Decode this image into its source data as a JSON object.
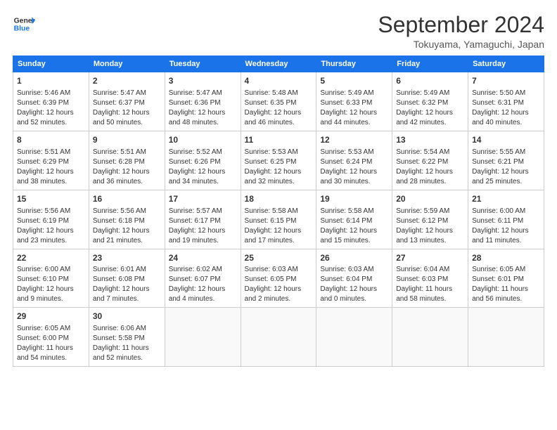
{
  "logo": {
    "line1": "General",
    "line2": "Blue"
  },
  "title": "September 2024",
  "location": "Tokuyama, Yamaguchi, Japan",
  "days_of_week": [
    "Sunday",
    "Monday",
    "Tuesday",
    "Wednesday",
    "Thursday",
    "Friday",
    "Saturday"
  ],
  "weeks": [
    [
      {
        "day": 1,
        "lines": [
          "Sunrise: 5:46 AM",
          "Sunset: 6:39 PM",
          "Daylight: 12 hours",
          "and 52 minutes."
        ]
      },
      {
        "day": 2,
        "lines": [
          "Sunrise: 5:47 AM",
          "Sunset: 6:37 PM",
          "Daylight: 12 hours",
          "and 50 minutes."
        ]
      },
      {
        "day": 3,
        "lines": [
          "Sunrise: 5:47 AM",
          "Sunset: 6:36 PM",
          "Daylight: 12 hours",
          "and 48 minutes."
        ]
      },
      {
        "day": 4,
        "lines": [
          "Sunrise: 5:48 AM",
          "Sunset: 6:35 PM",
          "Daylight: 12 hours",
          "and 46 minutes."
        ]
      },
      {
        "day": 5,
        "lines": [
          "Sunrise: 5:49 AM",
          "Sunset: 6:33 PM",
          "Daylight: 12 hours",
          "and 44 minutes."
        ]
      },
      {
        "day": 6,
        "lines": [
          "Sunrise: 5:49 AM",
          "Sunset: 6:32 PM",
          "Daylight: 12 hours",
          "and 42 minutes."
        ]
      },
      {
        "day": 7,
        "lines": [
          "Sunrise: 5:50 AM",
          "Sunset: 6:31 PM",
          "Daylight: 12 hours",
          "and 40 minutes."
        ]
      }
    ],
    [
      {
        "day": 8,
        "lines": [
          "Sunrise: 5:51 AM",
          "Sunset: 6:29 PM",
          "Daylight: 12 hours",
          "and 38 minutes."
        ]
      },
      {
        "day": 9,
        "lines": [
          "Sunrise: 5:51 AM",
          "Sunset: 6:28 PM",
          "Daylight: 12 hours",
          "and 36 minutes."
        ]
      },
      {
        "day": 10,
        "lines": [
          "Sunrise: 5:52 AM",
          "Sunset: 6:26 PM",
          "Daylight: 12 hours",
          "and 34 minutes."
        ]
      },
      {
        "day": 11,
        "lines": [
          "Sunrise: 5:53 AM",
          "Sunset: 6:25 PM",
          "Daylight: 12 hours",
          "and 32 minutes."
        ]
      },
      {
        "day": 12,
        "lines": [
          "Sunrise: 5:53 AM",
          "Sunset: 6:24 PM",
          "Daylight: 12 hours",
          "and 30 minutes."
        ]
      },
      {
        "day": 13,
        "lines": [
          "Sunrise: 5:54 AM",
          "Sunset: 6:22 PM",
          "Daylight: 12 hours",
          "and 28 minutes."
        ]
      },
      {
        "day": 14,
        "lines": [
          "Sunrise: 5:55 AM",
          "Sunset: 6:21 PM",
          "Daylight: 12 hours",
          "and 25 minutes."
        ]
      }
    ],
    [
      {
        "day": 15,
        "lines": [
          "Sunrise: 5:56 AM",
          "Sunset: 6:19 PM",
          "Daylight: 12 hours",
          "and 23 minutes."
        ]
      },
      {
        "day": 16,
        "lines": [
          "Sunrise: 5:56 AM",
          "Sunset: 6:18 PM",
          "Daylight: 12 hours",
          "and 21 minutes."
        ]
      },
      {
        "day": 17,
        "lines": [
          "Sunrise: 5:57 AM",
          "Sunset: 6:17 PM",
          "Daylight: 12 hours",
          "and 19 minutes."
        ]
      },
      {
        "day": 18,
        "lines": [
          "Sunrise: 5:58 AM",
          "Sunset: 6:15 PM",
          "Daylight: 12 hours",
          "and 17 minutes."
        ]
      },
      {
        "day": 19,
        "lines": [
          "Sunrise: 5:58 AM",
          "Sunset: 6:14 PM",
          "Daylight: 12 hours",
          "and 15 minutes."
        ]
      },
      {
        "day": 20,
        "lines": [
          "Sunrise: 5:59 AM",
          "Sunset: 6:12 PM",
          "Daylight: 12 hours",
          "and 13 minutes."
        ]
      },
      {
        "day": 21,
        "lines": [
          "Sunrise: 6:00 AM",
          "Sunset: 6:11 PM",
          "Daylight: 12 hours",
          "and 11 minutes."
        ]
      }
    ],
    [
      {
        "day": 22,
        "lines": [
          "Sunrise: 6:00 AM",
          "Sunset: 6:10 PM",
          "Daylight: 12 hours",
          "and 9 minutes."
        ]
      },
      {
        "day": 23,
        "lines": [
          "Sunrise: 6:01 AM",
          "Sunset: 6:08 PM",
          "Daylight: 12 hours",
          "and 7 minutes."
        ]
      },
      {
        "day": 24,
        "lines": [
          "Sunrise: 6:02 AM",
          "Sunset: 6:07 PM",
          "Daylight: 12 hours",
          "and 4 minutes."
        ]
      },
      {
        "day": 25,
        "lines": [
          "Sunrise: 6:03 AM",
          "Sunset: 6:05 PM",
          "Daylight: 12 hours",
          "and 2 minutes."
        ]
      },
      {
        "day": 26,
        "lines": [
          "Sunrise: 6:03 AM",
          "Sunset: 6:04 PM",
          "Daylight: 12 hours",
          "and 0 minutes."
        ]
      },
      {
        "day": 27,
        "lines": [
          "Sunrise: 6:04 AM",
          "Sunset: 6:03 PM",
          "Daylight: 11 hours",
          "and 58 minutes."
        ]
      },
      {
        "day": 28,
        "lines": [
          "Sunrise: 6:05 AM",
          "Sunset: 6:01 PM",
          "Daylight: 11 hours",
          "and 56 minutes."
        ]
      }
    ],
    [
      {
        "day": 29,
        "lines": [
          "Sunrise: 6:05 AM",
          "Sunset: 6:00 PM",
          "Daylight: 11 hours",
          "and 54 minutes."
        ]
      },
      {
        "day": 30,
        "lines": [
          "Sunrise: 6:06 AM",
          "Sunset: 5:58 PM",
          "Daylight: 11 hours",
          "and 52 minutes."
        ]
      },
      null,
      null,
      null,
      null,
      null
    ]
  ]
}
